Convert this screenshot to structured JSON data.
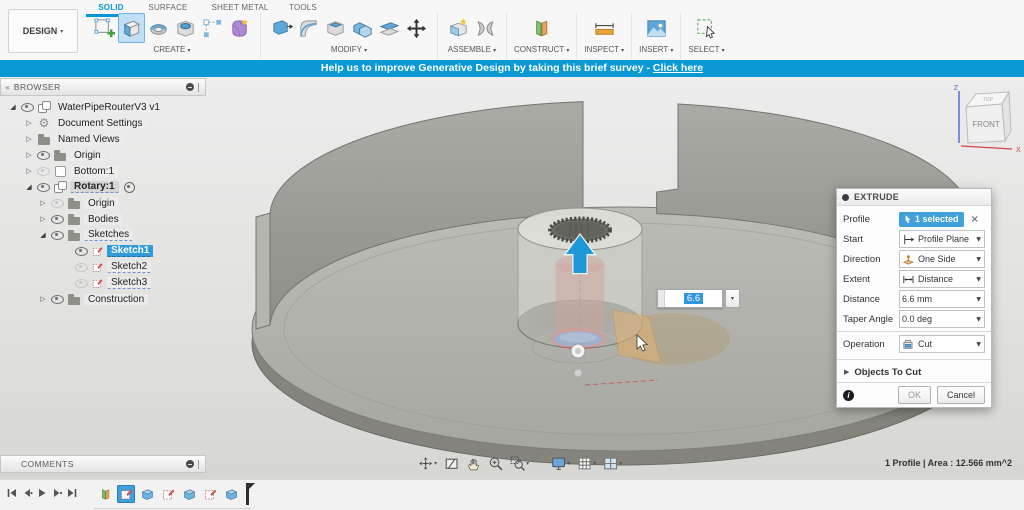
{
  "toolbar": {
    "design_label": "DESIGN",
    "tabs": [
      {
        "label": "SOLID",
        "active": true
      },
      {
        "label": "SURFACE",
        "active": false
      },
      {
        "label": "SHEET METAL",
        "active": false
      },
      {
        "label": "TOOLS",
        "active": false
      }
    ],
    "groups": [
      {
        "label": "CREATE",
        "items": [
          "create-sketch-icon",
          "extrude-icon",
          "revolve-icon",
          "hole-icon",
          "pattern-icon",
          "form-icon"
        ],
        "active_index": 1
      },
      {
        "label": "MODIFY",
        "items": [
          "press-pull-icon",
          "fillet-icon",
          "shell-icon",
          "combine-icon",
          "offset-face-icon",
          "move-icon"
        ],
        "active_index": -1
      },
      {
        "label": "ASSEMBLE",
        "items": [
          "new-component-icon",
          "joint-icon"
        ],
        "active_index": -1
      },
      {
        "label": "CONSTRUCT",
        "items": [
          "construct-plane-icon"
        ],
        "active_index": -1
      },
      {
        "label": "INSPECT",
        "items": [
          "measure-icon"
        ],
        "active_index": -1
      },
      {
        "label": "INSERT",
        "items": [
          "insert-image-icon"
        ],
        "active_index": -1
      },
      {
        "label": "SELECT",
        "items": [
          "select-icon"
        ],
        "active_index": -1
      }
    ]
  },
  "banner": {
    "text": "Help us to improve Generative Design by taking this brief survey - ",
    "link_label": "Click here"
  },
  "browser": {
    "title": "BROWSER",
    "items": [
      {
        "label": "WaterPipeRouterV3 v1",
        "level": 0,
        "expander": "expanded",
        "eye": "on",
        "icon": "component-icon"
      },
      {
        "label": "Document Settings",
        "level": 1,
        "expander": "collapsed",
        "eye": "none",
        "icon": "gear-icon"
      },
      {
        "label": "Named Views",
        "level": 1,
        "expander": "collapsed",
        "eye": "none",
        "icon": "folder-icon"
      },
      {
        "label": "Origin",
        "level": 1,
        "expander": "collapsed",
        "eye": "on",
        "icon": "folder-icon"
      },
      {
        "label": "Bottom:1",
        "level": 1,
        "expander": "collapsed",
        "eye": "off",
        "icon": "body-icon"
      },
      {
        "label": "Rotary:1",
        "level": 1,
        "expander": "expanded",
        "eye": "on",
        "icon": "component-icon",
        "active": true,
        "radio": true
      },
      {
        "label": "Origin",
        "level": 2,
        "expander": "collapsed",
        "eye": "off",
        "icon": "folder-icon"
      },
      {
        "label": "Bodies",
        "level": 2,
        "expander": "collapsed",
        "eye": "on",
        "icon": "folder-icon"
      },
      {
        "label": "Sketches",
        "level": 2,
        "expander": "expanded",
        "eye": "on",
        "icon": "folder-icon",
        "edit": true
      },
      {
        "label": "Sketch1",
        "level": 3,
        "expander": "none",
        "eye": "on",
        "icon": "sketch-icon",
        "selected": true
      },
      {
        "label": "Sketch2",
        "level": 3,
        "expander": "none",
        "eye": "off",
        "icon": "sketch-icon",
        "edit": true
      },
      {
        "label": "Sketch3",
        "level": 3,
        "expander": "none",
        "eye": "off",
        "icon": "sketch-icon",
        "edit": true
      },
      {
        "label": "Construction",
        "level": 2,
        "expander": "collapsed",
        "eye": "on",
        "icon": "folder-icon"
      }
    ]
  },
  "viewcube": {
    "front_label": "FRONT",
    "top_label": "TOP",
    "axis_z": "Z",
    "axis_x": "X"
  },
  "canvas": {
    "dim_input_value": "6.6"
  },
  "dialog": {
    "title": "EXTRUDE",
    "rows": [
      {
        "label": "Profile",
        "value": "1 selected",
        "type": "chip",
        "icon": "cursor-icon",
        "close_label": "×"
      },
      {
        "label": "Start",
        "value": "Profile Plane",
        "type": "dropdown",
        "icon": "profile-plane-icon"
      },
      {
        "label": "Direction",
        "value": "One Side",
        "type": "dropdown",
        "icon": "one-side-icon"
      },
      {
        "label": "Extent",
        "value": "Distance",
        "type": "dropdown",
        "icon": "distance-icon"
      },
      {
        "label": "Distance",
        "value": "6.6 mm",
        "type": "input"
      },
      {
        "label": "Taper Angle",
        "value": "0.0 deg",
        "type": "input"
      },
      {
        "label": "Operation",
        "value": "Cut",
        "type": "dropdown",
        "icon": "cut-icon",
        "separated": true
      }
    ],
    "objects_to_cut_label": "Objects To Cut",
    "ok_label": "OK",
    "cancel_label": "Cancel"
  },
  "navbar": {
    "icons": [
      {
        "name": "orbit-icon",
        "dropdown": true
      },
      {
        "name": "look-at-icon",
        "dropdown": false
      },
      {
        "name": "pan-icon",
        "dropdown": false
      },
      {
        "name": "zoom-icon",
        "dropdown": false
      },
      {
        "name": "window-zoom-icon",
        "dropdown": true
      },
      {
        "name": "gap"
      },
      {
        "name": "display-settings-icon",
        "dropdown": true
      },
      {
        "name": "grid-settings-icon",
        "dropdown": true
      },
      {
        "name": "viewports-icon",
        "dropdown": true
      }
    ]
  },
  "comments": {
    "title": "COMMENTS"
  },
  "status": {
    "selection_info": "1 Profile | Area : 12.566 mm^2"
  },
  "timeline": {
    "playback": [
      "go-to-start-icon",
      "step-back-icon",
      "play-icon",
      "step-forward-icon",
      "go-to-end-icon"
    ],
    "items": [
      {
        "icon": "construct-plane-icon",
        "selected": false
      },
      {
        "icon": "sketch-icon",
        "selected": true
      },
      {
        "icon": "extrude-feature-icon",
        "selected": false
      },
      {
        "icon": "sketch-icon",
        "selected": false
      },
      {
        "icon": "extrude-feature-icon",
        "selected": false
      },
      {
        "icon": "sketch-icon",
        "selected": false
      },
      {
        "icon": "extrude-feature-icon",
        "selected": false
      }
    ]
  }
}
